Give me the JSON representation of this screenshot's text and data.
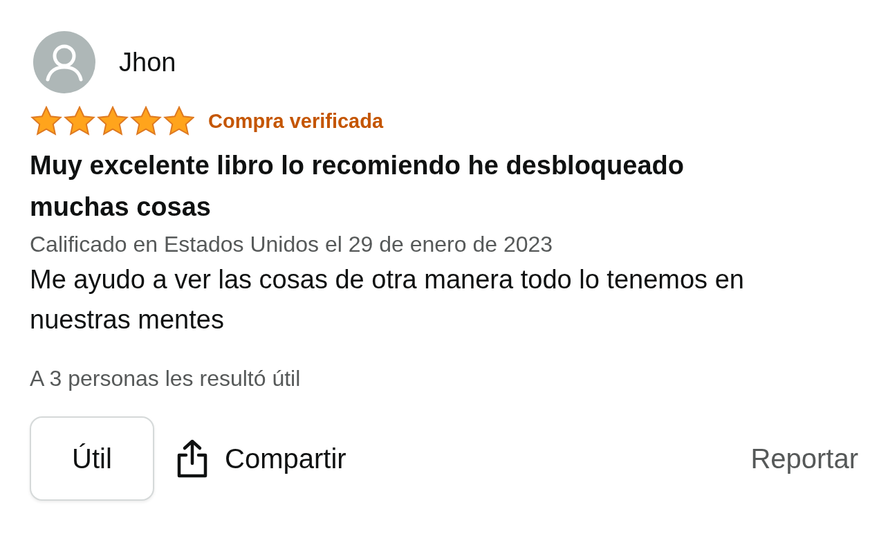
{
  "review": {
    "author": "Jhon",
    "stars": 5,
    "badge": "Compra verificada",
    "title": "Muy excelente libro lo recomiendo he desbloqueado muchas cosas",
    "date": "Calificado en Estados Unidos el 29 de enero de 2023",
    "body": "Me ayudo a ver las cosas de otra manera todo lo tenemos en nuestras mentes",
    "helpful_count": "A 3 personas les resultó útil"
  },
  "actions": {
    "helpful": "Útil",
    "share": "Compartir",
    "report": "Reportar"
  }
}
